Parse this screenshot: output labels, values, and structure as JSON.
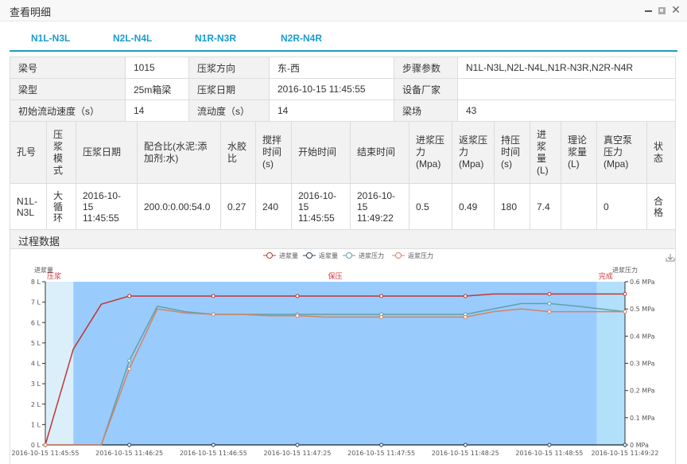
{
  "window": {
    "title": "查看明细",
    "buttons": {
      "minimize": "minimize",
      "maximize": "maximize",
      "close": "✕"
    }
  },
  "tabs": [
    {
      "label": "N1L-N3L",
      "active": true
    },
    {
      "label": "N2L-N4L",
      "active": false
    },
    {
      "label": "N1R-N3R",
      "active": false
    },
    {
      "label": "N2R-N4R",
      "active": false
    }
  ],
  "info": {
    "rows": [
      [
        {
          "label": "梁号",
          "value": "1015"
        },
        {
          "label": "压浆方向",
          "value": "东-西"
        },
        {
          "label": "步骤参数",
          "value": "N1L-N3L,N2L-N4L,N1R-N3R,N2R-N4R"
        }
      ],
      [
        {
          "label": "梁型",
          "value": "25m箱梁"
        },
        {
          "label": "压浆日期",
          "value": "2016-10-15 11:45:55"
        },
        {
          "label": "设备厂家",
          "value": ""
        }
      ],
      [
        {
          "label": "初始流动速度（s）",
          "value": "14"
        },
        {
          "label": "流动度（s）",
          "value": "14"
        },
        {
          "label": "梁场",
          "value": "43"
        }
      ]
    ]
  },
  "detail": {
    "headers": [
      "孔号",
      "压浆模式",
      "压浆日期",
      "配合比(水泥:添加剂:水)",
      "水胶比",
      "搅拌时间(s)",
      "开始时间",
      "结束时间",
      "进浆压力(Mpa)",
      "返浆压力(Mpa)",
      "持压时间(s)",
      "进浆量(L)",
      "理论浆量(L)",
      "真空泵压力(Mpa)",
      "状态"
    ],
    "rows": [
      [
        "N1L-N3L",
        "大循环",
        "2016-10-15 11:45:55",
        "200.0:0.00:54.0",
        "0.27",
        "240",
        "2016-10-15 11:45:55",
        "2016-10-15 11:49:22",
        "0.5",
        "0.49",
        "180",
        "7.4",
        "",
        "0",
        "合格"
      ]
    ]
  },
  "section": {
    "title": "过程数据"
  },
  "toolbox": {
    "download_icon": "download-icon"
  },
  "chart_data": {
    "type": "line",
    "title": "",
    "x": [
      "11:45:55",
      "11:46:05",
      "11:46:15",
      "11:46:25",
      "11:46:35",
      "11:46:45",
      "11:46:55",
      "11:47:05",
      "11:47:15",
      "11:47:25",
      "11:47:35",
      "11:47:45",
      "11:47:55",
      "11:48:05",
      "11:48:15",
      "11:48:25",
      "11:48:35",
      "11:48:45",
      "11:48:55",
      "11:49:05",
      "11:49:22"
    ],
    "x_seconds": [
      0,
      10,
      20,
      30,
      40,
      50,
      60,
      70,
      80,
      90,
      100,
      110,
      120,
      130,
      140,
      150,
      160,
      170,
      180,
      190,
      207
    ],
    "x_tick_labels": [
      "2016-10-15 11:45:55",
      "2016-10-15 11:46:25",
      "2016-10-15 11:46:55",
      "2016-10-15 11:47:25",
      "2016-10-15 11:47:55",
      "2016-10-15 11:48:25",
      "2016-10-15 11:48:55",
      "2016-10-15 11:49:22"
    ],
    "x_tick_seconds": [
      0,
      30,
      60,
      90,
      120,
      150,
      180,
      207
    ],
    "xlim": [
      0,
      207
    ],
    "y_left": {
      "label": "进浆量",
      "unit": "L",
      "range": [
        0,
        8
      ],
      "ticks": [
        0,
        1,
        2,
        3,
        4,
        5,
        6,
        7,
        8
      ]
    },
    "y_right": {
      "label": "进浆压力",
      "unit": "MPa",
      "range": [
        0,
        0.6
      ],
      "ticks": [
        0,
        0.1,
        0.2,
        0.3,
        0.4,
        0.5,
        0.6
      ]
    },
    "legend": {
      "position": "top-center",
      "entries": [
        "进浆量",
        "返浆量",
        "进浆压力",
        "返浆压力"
      ]
    },
    "series": [
      {
        "name": "进浆量",
        "axis": "left",
        "color": "#c23531",
        "values": [
          0,
          4.7,
          6.9,
          7.3,
          7.3,
          7.3,
          7.3,
          7.3,
          7.3,
          7.3,
          7.3,
          7.3,
          7.3,
          7.3,
          7.3,
          7.3,
          7.4,
          7.4,
          7.4,
          7.4,
          7.4
        ]
      },
      {
        "name": "返浆量",
        "axis": "left",
        "color": "#2f4554",
        "values": [
          0,
          0,
          0,
          0,
          0,
          0,
          0,
          0,
          0,
          0,
          0,
          0,
          0,
          0,
          0,
          0,
          0,
          0,
          0,
          0,
          0
        ]
      },
      {
        "name": "进浆压力",
        "axis": "right",
        "color": "#61a0a8",
        "values": [
          0,
          0,
          0,
          0.31,
          0.51,
          0.49,
          0.48,
          0.48,
          0.48,
          0.48,
          0.48,
          0.48,
          0.48,
          0.48,
          0.48,
          0.48,
          0.5,
          0.52,
          0.52,
          0.51,
          0.49
        ]
      },
      {
        "name": "返浆压力",
        "axis": "right",
        "color": "#d48265",
        "values": [
          0,
          0,
          0,
          0.28,
          0.5,
          0.485,
          0.48,
          0.48,
          0.475,
          0.475,
          0.47,
          0.47,
          0.47,
          0.47,
          0.47,
          0.47,
          0.49,
          0.5,
          0.49,
          0.49,
          0.49
        ]
      }
    ],
    "mark_areas": [
      {
        "label": "压浆",
        "start": 0,
        "end": 10,
        "color": "#dbeffb"
      },
      {
        "label": "保压",
        "start": 10,
        "end": 197,
        "color": "#99ccfd"
      },
      {
        "label": "完成",
        "start": 197,
        "end": 207,
        "color": "#b2e0fb"
      }
    ],
    "mark_label_color": "#d0393e",
    "symbol_seconds": [
      0,
      30,
      60,
      90,
      120,
      150,
      180,
      207
    ]
  }
}
